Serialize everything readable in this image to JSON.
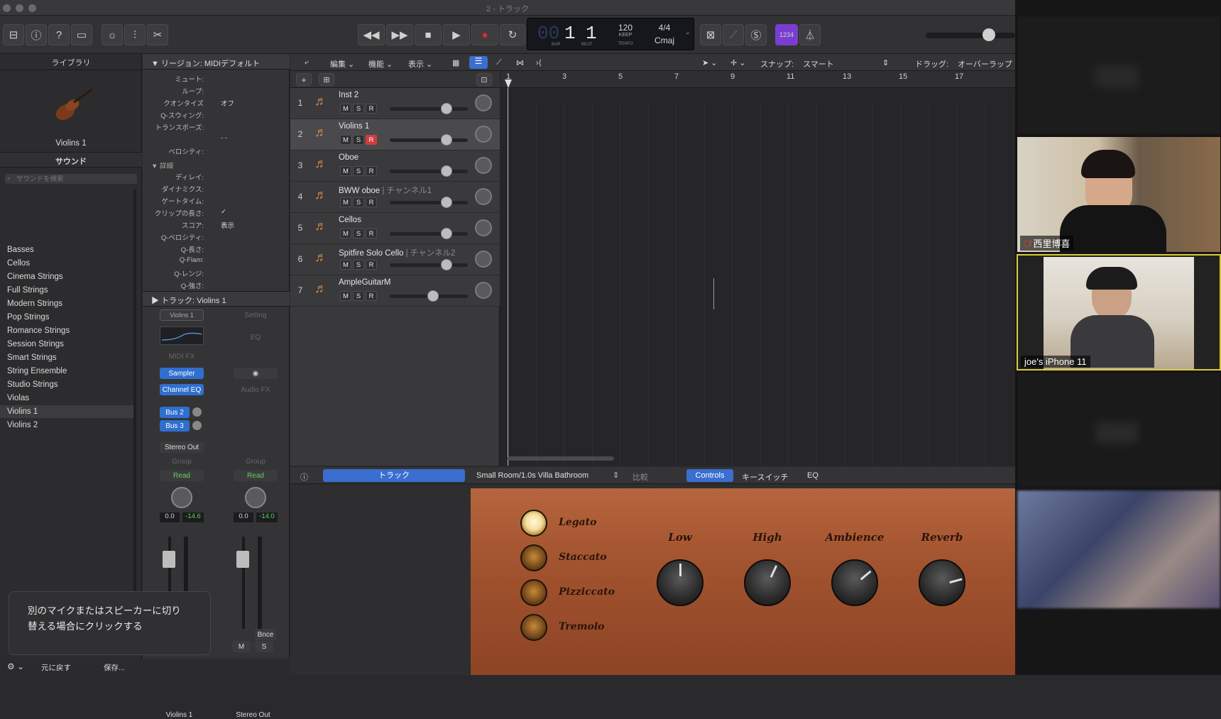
{
  "window": {
    "title": "2 - トラック"
  },
  "toolbar": {
    "lcd": {
      "bar": "1",
      "beat": "1",
      "bar_label": "BAR",
      "beat_label": "BEAT",
      "tempo": "120",
      "tempo_mode": "KEEP",
      "tempo_label": "TEMPO",
      "time_sig": "4/4",
      "key": "Cmaj",
      "faded_digits": "00"
    },
    "count_in": "1234"
  },
  "library": {
    "title": "ライブラリ",
    "patch_name": "Violins 1",
    "sound_header": "サウンド",
    "search_placeholder": "サウンドを検索",
    "items": [
      "Basses",
      "Cellos",
      "Cinema Strings",
      "Full Strings",
      "Modern Strings",
      "Pop Strings",
      "Romance Strings",
      "Session Strings",
      "Smart Strings",
      "String Ensemble",
      "Studio Strings",
      "Violas",
      "Violins 1",
      "Violins 2"
    ],
    "selected": "Violins 1"
  },
  "inspector": {
    "region_header": "リージョン: MIDIデフォルト",
    "params": [
      {
        "label": "ミュート:",
        "value": ""
      },
      {
        "label": "ループ:",
        "value": ""
      },
      {
        "label": "クオンタイズ",
        "value": "オフ"
      },
      {
        "label": "Q-スウィング:",
        "value": ""
      },
      {
        "label": "トランスポーズ:",
        "value": ""
      },
      {
        "label": "",
        "value": "- -"
      },
      {
        "label": "ベロシティ:",
        "value": ""
      }
    ],
    "detail_header": "詳細",
    "detail_params": [
      {
        "label": "ディレイ:",
        "value": ""
      },
      {
        "label": "ダイナミクス:",
        "value": ""
      },
      {
        "label": "ゲートタイム:",
        "value": ""
      },
      {
        "label": "クリップの長さ:",
        "value": "✓"
      },
      {
        "label": "スコア:",
        "value": "表示"
      },
      {
        "label": "Q-ベロシティ:",
        "value": ""
      },
      {
        "label": "Q-長さ:",
        "value": ""
      },
      {
        "label": "Q-Flam:",
        "value": ""
      },
      {
        "label": "Q-レンジ:",
        "value": ""
      },
      {
        "label": "Q-強さ:",
        "value": ""
      }
    ],
    "track_header": "トラック:",
    "track_name": "Violins 1",
    "strip1": {
      "name": "Violins 1",
      "setting": "Setting",
      "midi_fx": "MIDI FX",
      "sampler": "Sampler",
      "channel_eq": "Channel EQ",
      "bus2": "Bus 2",
      "bus3": "Bus 3",
      "output": "Stereo Out",
      "group": "Group",
      "read": "Read",
      "vol": "0.0",
      "peak": "-14.6"
    },
    "strip2": {
      "name": "Stereo Out",
      "setting": "Setting",
      "eq": "EQ",
      "audio_fx": "Audio FX",
      "group": "Group",
      "read": "Read",
      "vol": "0.0",
      "peak": "-14.0",
      "bounce": "Bnce",
      "m": "M",
      "s": "S"
    }
  },
  "tracks_toolbar": {
    "edit": "編集",
    "functions": "機能",
    "view": "表示",
    "snap_label": "スナップ:",
    "snap_value": "スマート",
    "drag_label": "ドラッグ:",
    "drag_value": "オーバーラップ"
  },
  "tracks": [
    {
      "num": "1",
      "name": "Inst 2",
      "sub": "",
      "rec": false,
      "fader": 0.73
    },
    {
      "num": "2",
      "name": "Violins 1",
      "sub": "",
      "rec": true,
      "fader": 0.73
    },
    {
      "num": "3",
      "name": "Oboe",
      "sub": "",
      "rec": false,
      "fader": 0.73
    },
    {
      "num": "4",
      "name": "BWW oboe",
      "sub": "| チャンネル1",
      "rec": false,
      "fader": 0.73
    },
    {
      "num": "5",
      "name": "Cellos",
      "sub": "",
      "rec": false,
      "fader": 0.73
    },
    {
      "num": "6",
      "name": "Spitfire Solo Cello",
      "sub": "| チャンネル2",
      "rec": false,
      "fader": 0.73
    },
    {
      "num": "7",
      "name": "AmpleGuitarM",
      "sub": "",
      "rec": false,
      "fader": 0.55
    }
  ],
  "ruler": [
    "1",
    "3",
    "5",
    "7",
    "9",
    "11",
    "13",
    "15",
    "17"
  ],
  "editor": {
    "tab_track": "トラック",
    "preset": "Small Room/1.0s Villa Bathroom",
    "compare": "比較",
    "tab_controls": "Controls",
    "tab_keyswitch": "キースイッチ",
    "tab_eq": "EQ",
    "articulations": [
      {
        "label": "Legato",
        "on": true
      },
      {
        "label": "Staccato",
        "on": false
      },
      {
        "label": "Pizziccato",
        "on": false
      },
      {
        "label": "Tremolo",
        "on": false
      }
    ],
    "knobs": [
      "Low",
      "High",
      "Ambience",
      "Reverb"
    ]
  },
  "zoom": {
    "participants": [
      {
        "name": "西里博喜",
        "muted": true
      },
      {
        "name": "joe's iPhone 11",
        "muted": false,
        "active": true
      }
    ]
  },
  "tooltip": {
    "text1": "別のマイクまたはスピーカーに切り",
    "text2": "替える場合にクリックする"
  },
  "bottombar": {
    "undo": "元に戻す",
    "save": "保存..."
  }
}
